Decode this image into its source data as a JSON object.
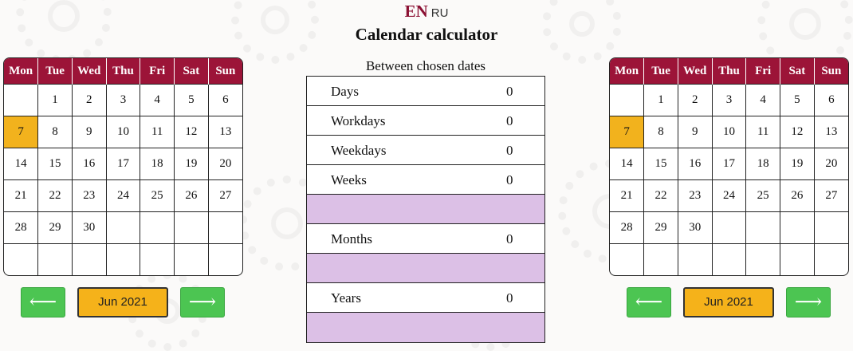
{
  "header": {
    "lang_en": "EN",
    "lang_ru": "RU",
    "title": "Calendar calculator"
  },
  "weekdays": [
    "Mon",
    "Tue",
    "Wed",
    "Thu",
    "Fri",
    "Sat",
    "Sun"
  ],
  "left_calendar": {
    "month_label": "Jun 2021",
    "selected_day": "7",
    "weeks": [
      [
        "",
        "1",
        "2",
        "3",
        "4",
        "5",
        "6"
      ],
      [
        "7",
        "8",
        "9",
        "10",
        "11",
        "12",
        "13"
      ],
      [
        "14",
        "15",
        "16",
        "17",
        "18",
        "19",
        "20"
      ],
      [
        "21",
        "22",
        "23",
        "24",
        "25",
        "26",
        "27"
      ],
      [
        "28",
        "29",
        "30",
        "",
        "",
        "",
        ""
      ],
      [
        "",
        "",
        "",
        "",
        "",
        "",
        ""
      ]
    ],
    "prev_label": "⟵",
    "next_label": "⟶"
  },
  "right_calendar": {
    "month_label": "Jun 2021",
    "selected_day": "7",
    "weeks": [
      [
        "",
        "1",
        "2",
        "3",
        "4",
        "5",
        "6"
      ],
      [
        "7",
        "8",
        "9",
        "10",
        "11",
        "12",
        "13"
      ],
      [
        "14",
        "15",
        "16",
        "17",
        "18",
        "19",
        "20"
      ],
      [
        "21",
        "22",
        "23",
        "24",
        "25",
        "26",
        "27"
      ],
      [
        "28",
        "29",
        "30",
        "",
        "",
        "",
        ""
      ],
      [
        "",
        "",
        "",
        "",
        "",
        "",
        ""
      ]
    ],
    "prev_label": "⟵",
    "next_label": "⟶"
  },
  "results": {
    "caption": "Between chosen dates",
    "rows": [
      {
        "label": "Days",
        "value": "0"
      },
      {
        "label": "Workdays",
        "value": "0"
      },
      {
        "label": "Weekdays",
        "value": "0"
      },
      {
        "label": "Weeks",
        "value": "0"
      },
      {
        "label": "",
        "value": ""
      },
      {
        "label": "Months",
        "value": "0"
      },
      {
        "label": "",
        "value": ""
      },
      {
        "label": "Years",
        "value": "0"
      },
      {
        "label": "",
        "value": ""
      }
    ]
  },
  "colors": {
    "header_bg": "#9c1438",
    "selected_day": "#f2b21d",
    "arrow_button": "#4cc552",
    "month_button": "#f5b21a",
    "filler_row": "#dcc0e6"
  }
}
